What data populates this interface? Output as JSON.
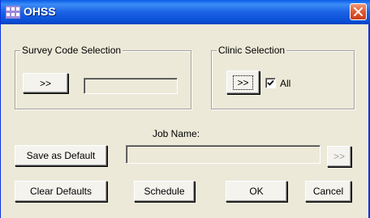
{
  "window": {
    "title": "OHSS"
  },
  "survey_group": {
    "label": "Survey Code Selection",
    "select_button": ">>",
    "value": ""
  },
  "clinic_group": {
    "label": "Clinic Selection",
    "select_button": ">>",
    "all_label": "All",
    "all_checked": true
  },
  "job": {
    "label": "Job Name:",
    "value": "",
    "browse_button": ">>"
  },
  "buttons": {
    "save_default": "Save as Default",
    "clear_defaults": "Clear Defaults",
    "schedule": "Schedule",
    "ok": "OK",
    "cancel": "Cancel"
  },
  "icons": {
    "close": "close-icon",
    "app": "app-icon",
    "check": "check-icon"
  }
}
